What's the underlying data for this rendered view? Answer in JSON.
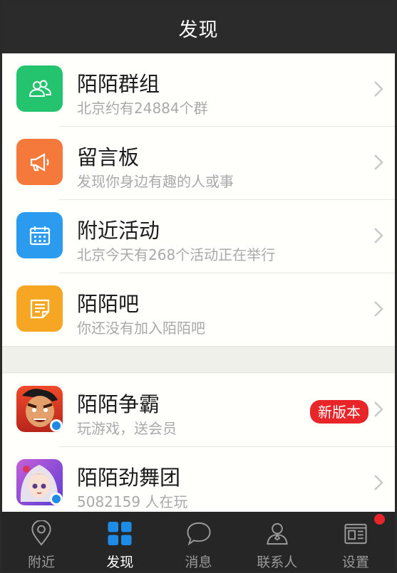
{
  "header": {
    "title": "发现"
  },
  "sections": {
    "apps": [
      {
        "title": "陌陌群组",
        "subtitle": "北京约有24884个群",
        "icon": "group-icon",
        "color": "#24c46f"
      },
      {
        "title": "留言板",
        "subtitle": "发现你身边有趣的人或事",
        "icon": "megaphone-icon",
        "color": "#f5793a"
      },
      {
        "title": "附近活动",
        "subtitle": "北京今天有268个活动正在举行",
        "icon": "calendar-icon",
        "color": "#2a9bef"
      },
      {
        "title": "陌陌吧",
        "subtitle": "你还没有加入陌陌吧",
        "icon": "note-icon",
        "color": "#f6a623"
      }
    ],
    "games": [
      {
        "title": "陌陌争霸",
        "subtitle": "玩游戏，送会员",
        "badge": "新版本",
        "icon": "warrior-avatar-icon"
      },
      {
        "title": "陌陌劲舞团",
        "subtitle": "5082159 人在玩",
        "icon": "dancer-avatar-icon"
      }
    ]
  },
  "tabbar": {
    "tabs": [
      {
        "label": "附近",
        "icon": "location-pin-icon"
      },
      {
        "label": "发现",
        "icon": "grid-icon",
        "active": true
      },
      {
        "label": "消息",
        "icon": "chat-bubble-icon"
      },
      {
        "label": "联系人",
        "icon": "contacts-icon"
      },
      {
        "label": "设置",
        "icon": "settings-card-icon",
        "notification_dot": true
      }
    ]
  },
  "colors": {
    "accent": "#1e8be6",
    "badge_red": "#e8262a",
    "header_bg": "#2b2b2b"
  }
}
